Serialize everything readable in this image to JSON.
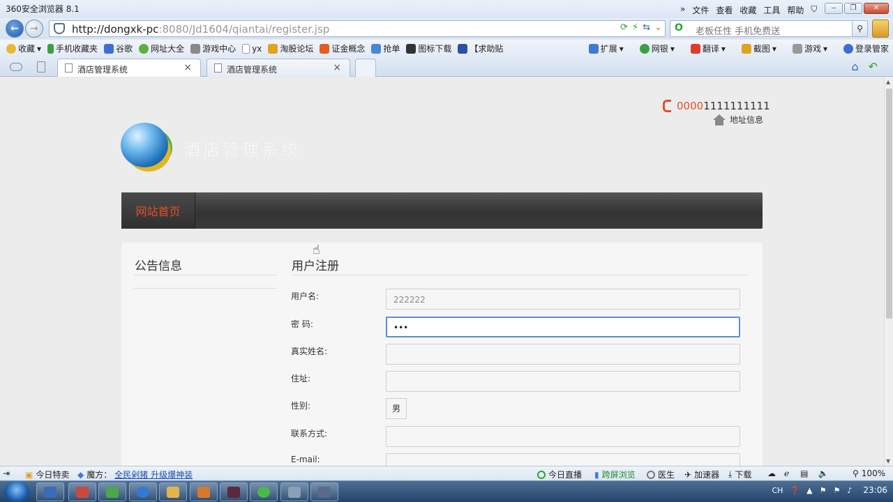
{
  "browser": {
    "title": "360安全浏览器 8.1",
    "menus": [
      "文件",
      "查看",
      "收藏",
      "工具",
      "帮助"
    ],
    "url_host": "http://dongxk-pc",
    "url_rest": ":8080/Jd1604/qiantai/register.jsp",
    "search_placeholder": "老板任性 手机免费送",
    "bookmarks": [
      {
        "label": "收藏",
        "color": "#e8b838"
      },
      {
        "label": "手机收藏夹",
        "color": "#3aa040"
      },
      {
        "label": "谷歌",
        "color": "#3b6fd6"
      },
      {
        "label": "网址大全",
        "color": "#5bb13a"
      },
      {
        "label": "游戏中心",
        "color": "#8a8a8a"
      },
      {
        "label": "yx",
        "color": "#bbbbbb"
      },
      {
        "label": "淘股论坛",
        "color": "#e3a21d"
      },
      {
        "label": "证金概念",
        "color": "#e65c1d"
      },
      {
        "label": "抢单",
        "color": "#4a86d6"
      },
      {
        "label": "图标下载",
        "color": "#333333"
      },
      {
        "label": "【求助贴",
        "color": "#2b4fa8"
      }
    ],
    "bookmarks_right": [
      "扩展",
      "网银",
      "翻译",
      "截图",
      "游戏",
      "登录管家"
    ],
    "tabs": [
      "酒店管理系统",
      "酒店管理系统"
    ]
  },
  "page": {
    "phone_prefix": "0000",
    "phone_rest": "1111111111",
    "address_label": "地址信息",
    "site_name": "酒店管理系统",
    "nav_home": "网站首页",
    "notice_title": "公告信息",
    "register_title": "用户注册",
    "form": {
      "username_label": "用户名:",
      "username_value": "222222",
      "password_label": "密 码:",
      "password_value": "•••",
      "realname_label": "真实姓名:",
      "address_label": "住址:",
      "gender_label": "性别:",
      "gender_value": "男",
      "contact_label": "联系方式:",
      "email_label": "E-mail:"
    }
  },
  "statusbar": {
    "today_deals": "今日特卖",
    "magic_label": "魔方：",
    "magic_link": "全民剁猪 升级爆神装",
    "live": "今日直播",
    "cross_screen": "跨屏浏览",
    "doctor": "医生",
    "accelerator": "加速器",
    "download": "下载",
    "zoom": "100%"
  },
  "taskbar": {
    "lang": "CH",
    "clock": "23:06",
    "apps": [
      {
        "color": "#3a6db8"
      },
      {
        "color": "#c84a3a"
      },
      {
        "color": "#4aa84a"
      },
      {
        "color": "#2f7ad6"
      },
      {
        "color": "#e2b54a"
      },
      {
        "color": "#d8782a"
      },
      {
        "color": "#5a2a3a"
      },
      {
        "color": "#4ab84a"
      },
      {
        "color": "#8aa0b8"
      },
      {
        "color": "#5a6a8a"
      }
    ]
  }
}
